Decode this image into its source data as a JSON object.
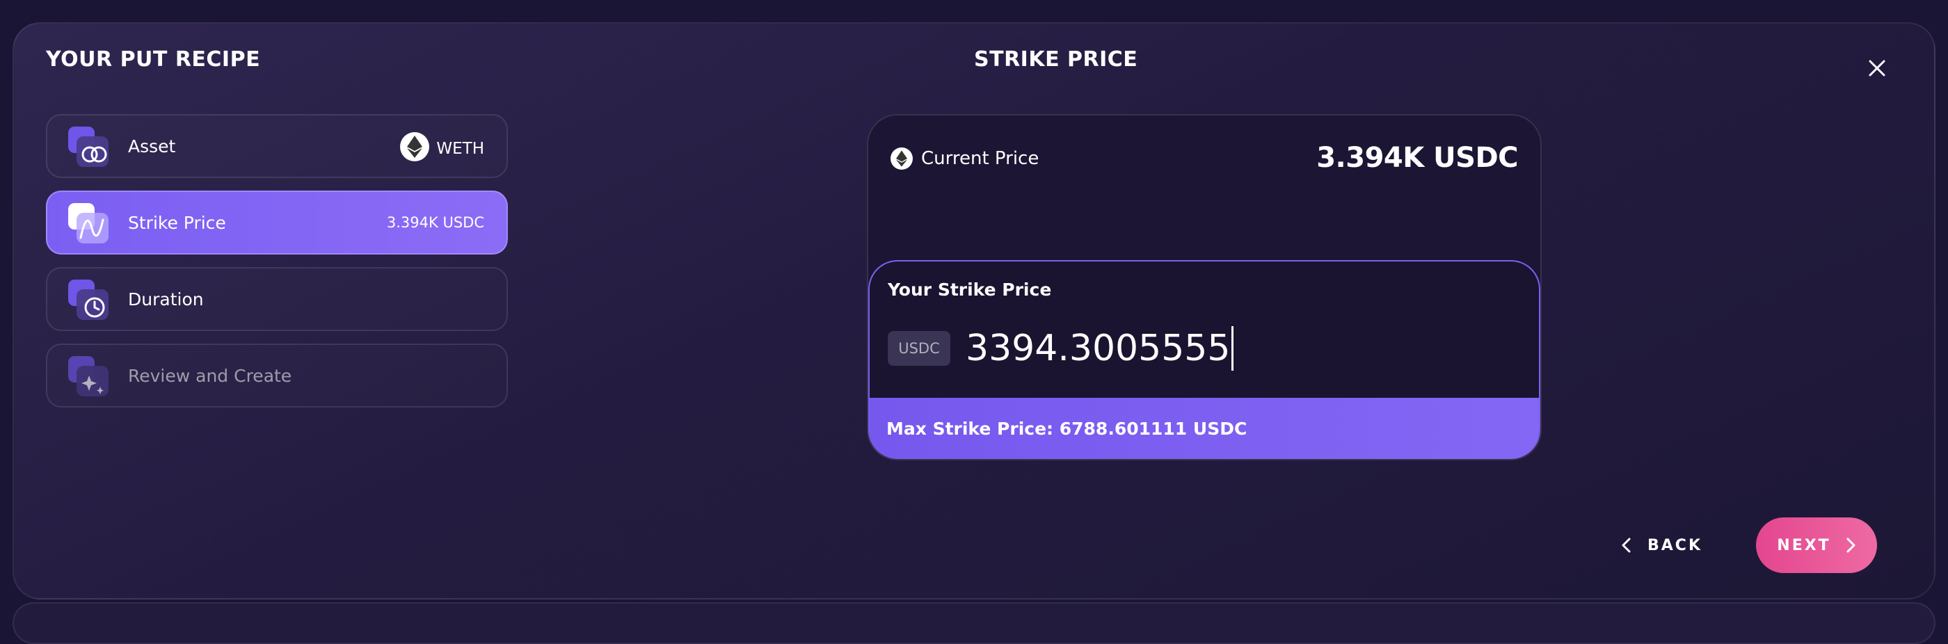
{
  "left_title": "YOUR PUT RECIPE",
  "center_title": "STRIKE PRICE",
  "steps": [
    {
      "label": "Asset",
      "value": "WETH",
      "state": "default",
      "icon": "asset-icon"
    },
    {
      "label": "Strike Price",
      "value": "3.394K USDC",
      "state": "active",
      "icon": "strike-price-icon"
    },
    {
      "label": "Duration",
      "value": "",
      "state": "default",
      "icon": "duration-clock-icon"
    },
    {
      "label": "Review and Create",
      "value": "",
      "state": "disabled",
      "icon": "review-sparkle-icon"
    }
  ],
  "current_price": {
    "label": "Current Price",
    "value": "3.394K USDC"
  },
  "strike": {
    "label": "Your Strike Price",
    "unit": "USDC",
    "value": "3394.3005555",
    "max_text": "Max Strike Price: 6788.601111 USDC"
  },
  "nav": {
    "back_label": "BACK",
    "next_label": "NEXT"
  },
  "colors": {
    "background": "#1b1535",
    "accent_purple": "#7b5ff2",
    "next_pink": "#e4468f"
  }
}
